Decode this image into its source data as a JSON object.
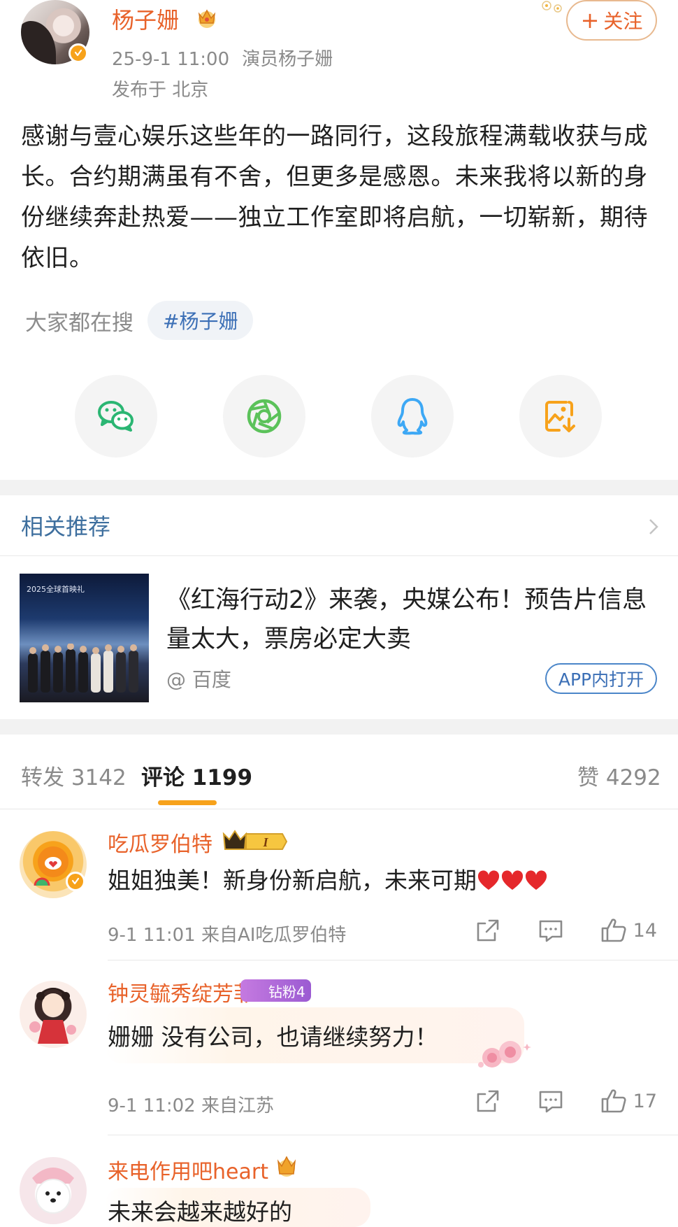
{
  "post": {
    "author": "杨子姗",
    "date": "25-9-1 11:00",
    "identity": "演员杨子姗",
    "location": "发布于 北京",
    "follow_label": "关注",
    "follow_plus": "+",
    "body": "感谢与壹心娱乐这些年的一路同行，这段旅程满载收获与成长。合约期满虽有不舍，但更多是感恩。未来我将以新的身份继续奔赴热爱——独立工作室即将启航，一切崭新，期待依旧。"
  },
  "search": {
    "label": "大家都在搜",
    "tag": "#杨子姗"
  },
  "share": {
    "items": [
      "wechat-icon",
      "moments-icon",
      "qq-icon",
      "save-image-icon"
    ],
    "colors": {
      "wechat": "#2bb673",
      "moments": "#5bc25a",
      "qq": "#3da8f5",
      "save": "#f7a21b"
    }
  },
  "related": {
    "title": "相关推荐",
    "headline": "《红海行动2》来袭，央媒公布！预告片信息量太大，票房必定大卖",
    "source_at": "@",
    "source": "百度",
    "open_button": "APP内打开",
    "thumb_caption": "2025全球首映礼"
  },
  "tabs": {
    "repost_label": "转发",
    "repost_count": "3142",
    "comment_label": "评论",
    "comment_count": "1199",
    "like_label": "赞",
    "like_count": "4292"
  },
  "comments": [
    {
      "name": "吃瓜罗伯特",
      "badge": "I",
      "text": "姐姐独美！新身份新启航，未来可期",
      "time": "9-1 11:01",
      "from": "来自AI吃瓜罗伯特",
      "likes": "14"
    },
    {
      "name": "钟灵毓秀绽芳菲",
      "badge": "钻粉4",
      "text": "姗姗 没有公司，也请继续努力！",
      "time": "9-1 11:02",
      "from": "来自江苏",
      "likes": "17"
    },
    {
      "name": "来电作用吧heart",
      "text": "未来会越来越好的"
    }
  ],
  "colors": {
    "accent_orange": "#e8622a",
    "link_blue": "#3b6fb6",
    "tab_underline": "#f7a21b"
  }
}
